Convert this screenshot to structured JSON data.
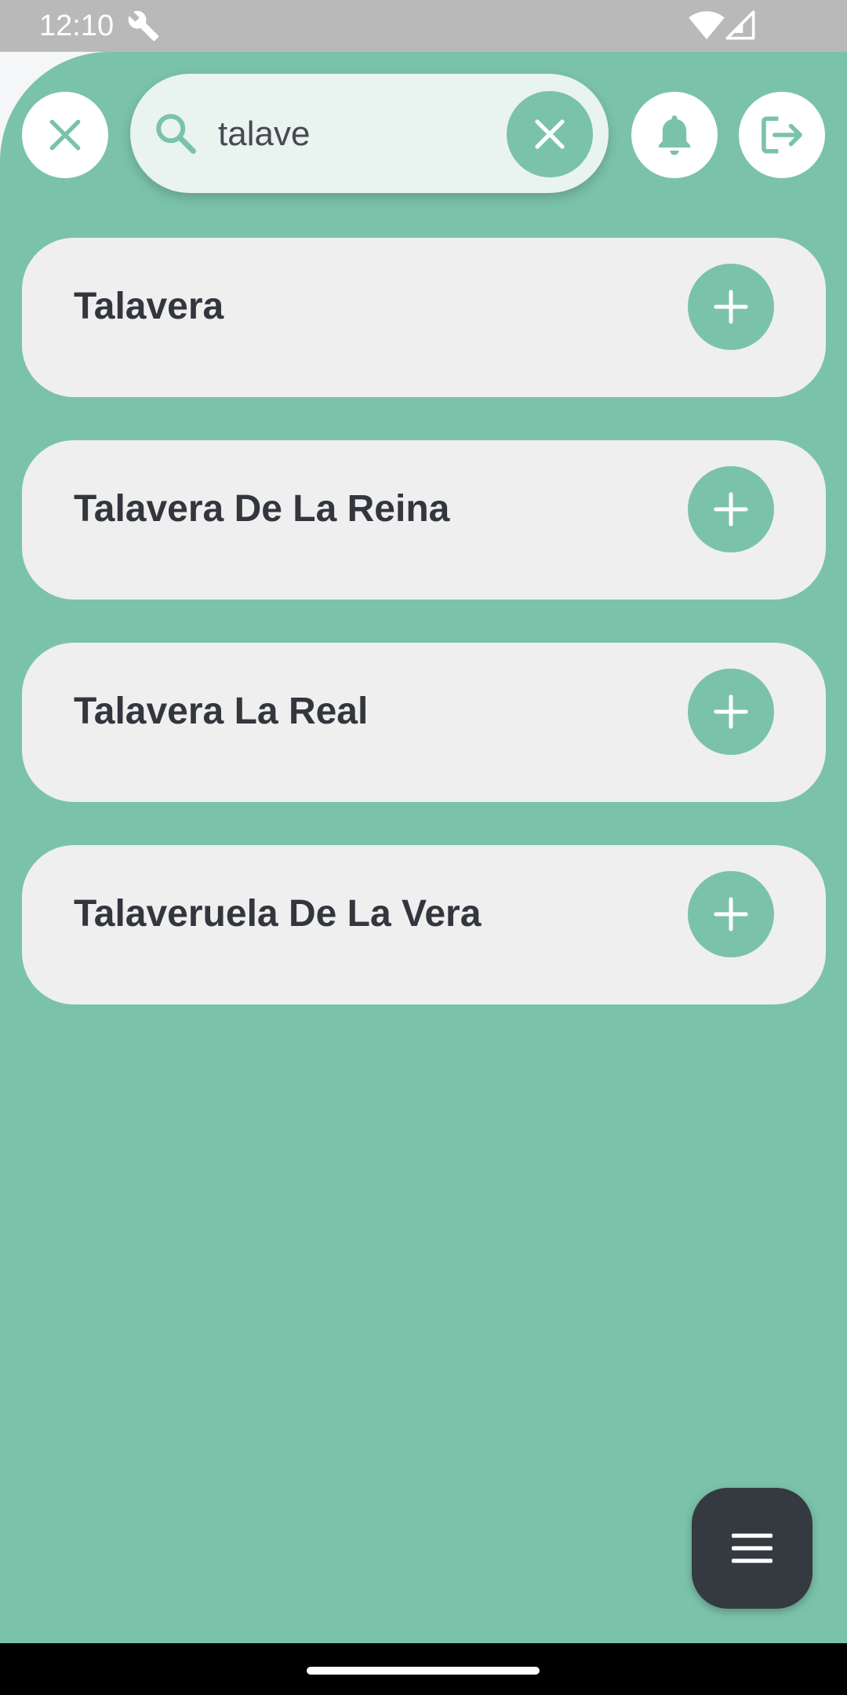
{
  "status_bar": {
    "time": "12:10"
  },
  "header": {
    "search": {
      "value": "talave"
    }
  },
  "results": [
    {
      "name": "Talavera"
    },
    {
      "name": "Talavera De La Reina"
    },
    {
      "name": "Talavera La Real"
    },
    {
      "name": "Talaveruela De La Vera"
    }
  ],
  "icons": {
    "close": "close-icon",
    "search": "search-icon",
    "clear": "clear-icon",
    "bell": "bell-icon",
    "logout": "logout-icon",
    "add": "plus-icon",
    "menu": "menu-icon"
  },
  "colors": {
    "accent": "#7bc2ab",
    "card": "#efefef",
    "text": "#33363d",
    "fab": "#343a40"
  }
}
